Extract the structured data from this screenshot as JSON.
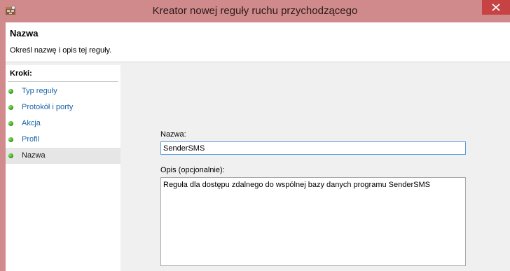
{
  "window": {
    "title": "Kreator nowej reguły ruchu przychodzącego"
  },
  "header": {
    "title": "Nazwa",
    "description": "Określ nazwę i opis tej reguły."
  },
  "steps": {
    "heading": "Kroki:",
    "items": [
      {
        "label": "Typ reguły",
        "active": false
      },
      {
        "label": "Protokół i porty",
        "active": false
      },
      {
        "label": "Akcja",
        "active": false
      },
      {
        "label": "Profil",
        "active": false
      },
      {
        "label": "Nazwa",
        "active": true
      }
    ]
  },
  "form": {
    "name_label": "Nazwa:",
    "name_value": "SenderSMS",
    "description_label": "Opis (opcjonalnie):",
    "description_value": "Reguła dla dostępu zdalnego do wspólnej bazy danych programu SenderSMS"
  },
  "icons": {
    "app": "firewall-wizard-icon",
    "close": "close-icon",
    "step_status": "green-dot-icon"
  },
  "colors": {
    "title_bar": "#d08a8c",
    "close_button": "#c74343",
    "link": "#1c64a8",
    "input_focus_border": "#5b9bd5",
    "step_dot": "#3aa51f"
  }
}
